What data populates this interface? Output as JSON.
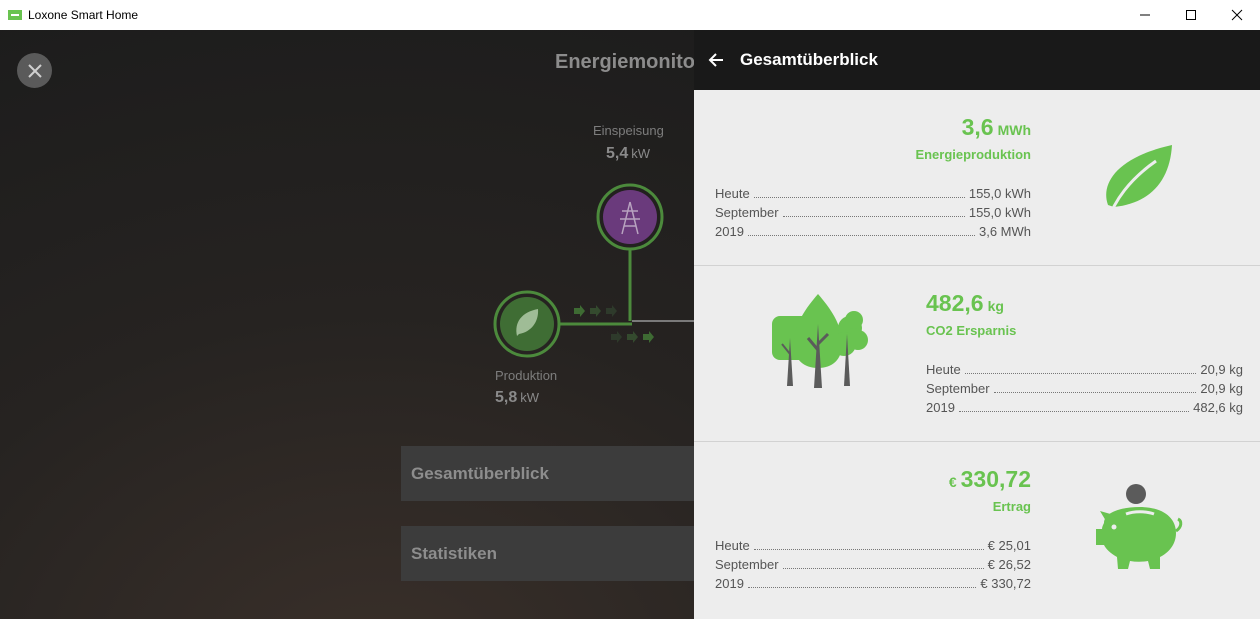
{
  "window": {
    "title": "Loxone Smart Home"
  },
  "background": {
    "title": "Energiemonitor",
    "nodes": {
      "feed_in": {
        "label": "Einspeisung",
        "value": "5,4",
        "unit": "kW"
      },
      "production": {
        "label": "Produktion",
        "value": "5,8",
        "unit": "kW"
      }
    },
    "cards": [
      {
        "label": "Gesamtüberblick"
      },
      {
        "label": "Statistiken"
      }
    ]
  },
  "panel": {
    "title": "Gesamtüberblick",
    "sections": [
      {
        "value": "3,6",
        "unit": "MWh",
        "label": "Energieproduktion",
        "icon": "leaf-icon",
        "rows": [
          {
            "label": "Heute",
            "value": "155,0  kWh"
          },
          {
            "label": "September",
            "value": "155,0  kWh"
          },
          {
            "label": "2019",
            "value": "3,6  MWh"
          }
        ]
      },
      {
        "value": "482,6",
        "unit": "kg",
        "label": "CO2 Ersparnis",
        "icon": "trees-icon",
        "rows": [
          {
            "label": "Heute",
            "value": "20,9 kg"
          },
          {
            "label": "September",
            "value": "20,9 kg"
          },
          {
            "label": "2019",
            "value": "482,6 kg"
          }
        ]
      },
      {
        "currency": "€",
        "value": "330,72",
        "label": "Ertrag",
        "icon": "piggy-bank-icon",
        "rows": [
          {
            "label": "Heute",
            "value": "€ 25,01"
          },
          {
            "label": "September",
            "value": "€ 26,52"
          },
          {
            "label": "2019",
            "value": "€ 330,72"
          }
        ]
      }
    ]
  },
  "colors": {
    "accent_green": "#69c350",
    "grid_purple": "#7b3f8f",
    "panel_header": "#191919",
    "panel_bg": "#ededed"
  }
}
